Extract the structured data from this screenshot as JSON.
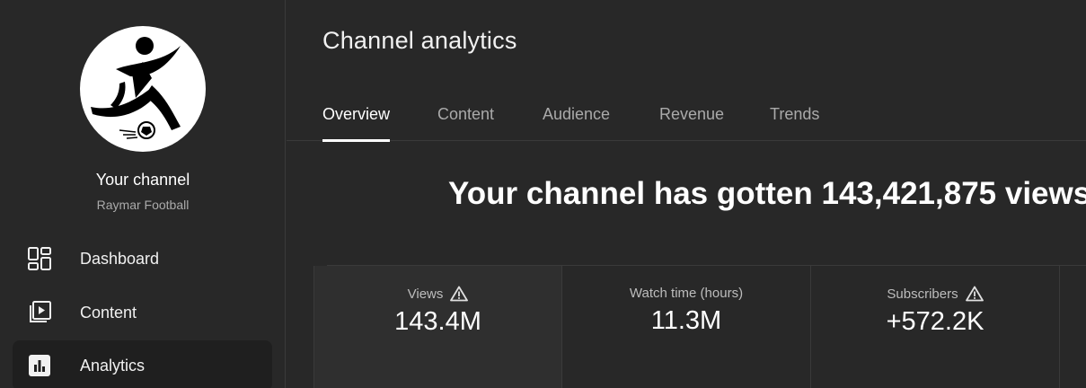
{
  "sidebar": {
    "channel_label": "Your channel",
    "channel_name": "Raymar Football",
    "items": [
      {
        "label": "Dashboard",
        "icon": "dashboard-icon"
      },
      {
        "label": "Content",
        "icon": "content-icon"
      },
      {
        "label": "Analytics",
        "icon": "analytics-icon",
        "active": true
      }
    ]
  },
  "main": {
    "title": "Channel analytics",
    "tabs": [
      {
        "label": "Overview",
        "active": true
      },
      {
        "label": "Content"
      },
      {
        "label": "Audience"
      },
      {
        "label": "Revenue"
      },
      {
        "label": "Trends"
      }
    ],
    "headline": "Your channel has gotten 143,421,875 views",
    "metrics": [
      {
        "label": "Views",
        "value": "143.4M",
        "warning": true
      },
      {
        "label": "Watch time (hours)",
        "value": "11.3M",
        "warning": false
      },
      {
        "label": "Subscribers",
        "value": "+572.2K",
        "warning": true
      }
    ]
  },
  "colors": {
    "background": "#282828",
    "active_nav": "#1f1f1f",
    "text_secondary": "#aaaaaa"
  }
}
